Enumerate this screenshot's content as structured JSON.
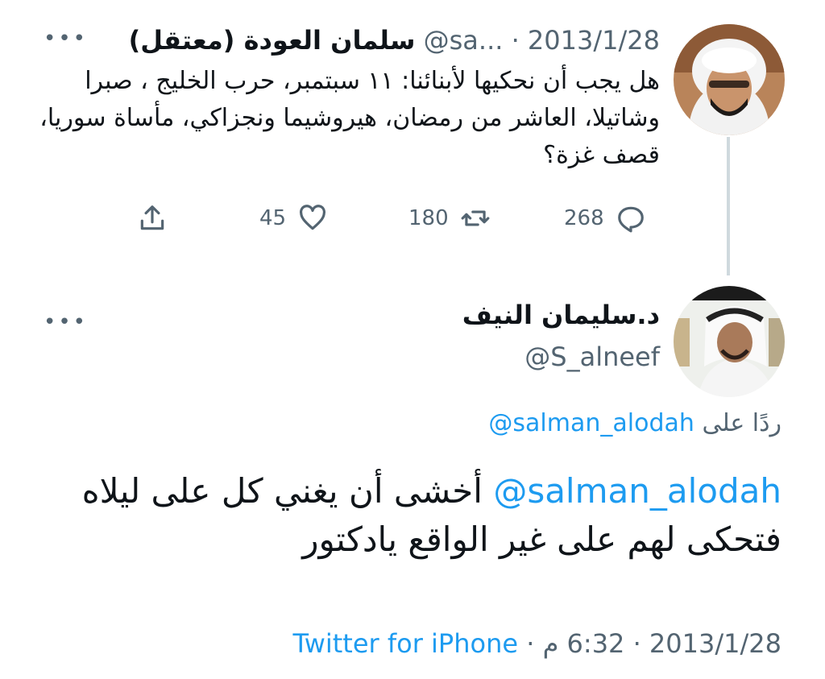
{
  "parent_tweet": {
    "author_name": "سلمان العودة (معتقل)",
    "handle_truncated": "@sa...",
    "separator": "·",
    "date": "2013/1/28",
    "more_label": "•••",
    "text": "هل يجب أن نحكيها لأبنائنا: ١١ سبتمبر، حرب الخليج ، صبرا وشاتيلا، العاشر من رمضان، هيروشيما ونجزاكي، مأساة سوريا، قصف غزة؟",
    "replies_count": "268",
    "retweets_count": "180",
    "likes_count": "45",
    "icons": {
      "reply": "reply-icon",
      "retweet": "retweet-icon",
      "like": "heart-icon",
      "share": "share-icon"
    }
  },
  "reply_tweet": {
    "author_name": "د.سليمان النيف",
    "handle": "@S_alneef",
    "more_label": "•••",
    "replying_to_label": "ردًا على",
    "replying_to_handle": "@salman_alodah",
    "mention": "@salman_alodah",
    "text": "أخشى أن يغني كل على ليلاه فتحكى لهم على غير الواقع يادكتور",
    "date": "2013/1/28",
    "separator": "·",
    "time": "6:32 م",
    "source": "Twitter for iPhone"
  },
  "colors": {
    "link": "#1d9bf0",
    "secondary": "#536471",
    "text": "#0f1419",
    "thread_line": "#cfd9de"
  }
}
